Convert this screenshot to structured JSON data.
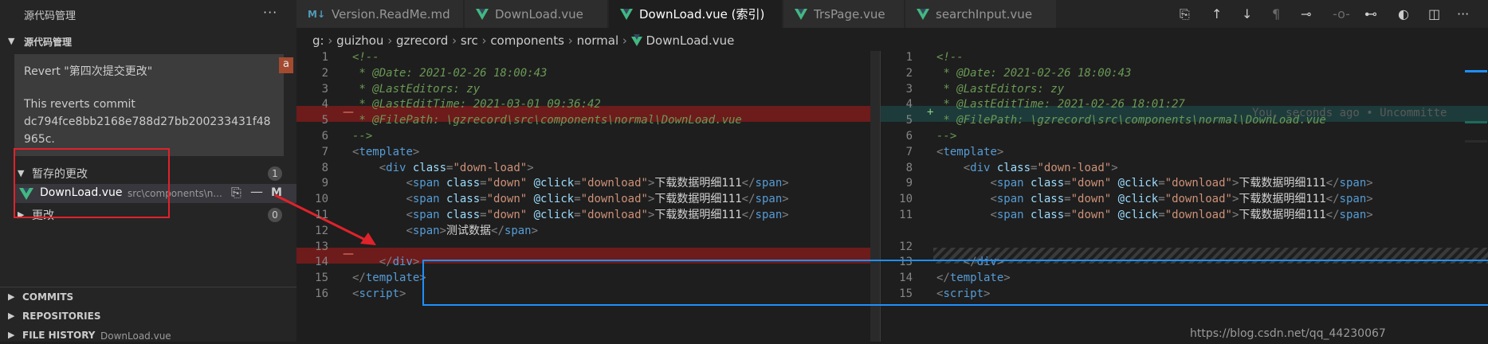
{
  "sidebar": {
    "title": "源代码管理",
    "more_icon": "ellipsis-icon",
    "scm_section": "源代码管理",
    "commit_message": {
      "lines": [
        "Revert \"第四次提交更改\"",
        "",
        "This reverts commit",
        "dc794fce8bb2168e788d27bb200233431f48",
        "965c."
      ],
      "badge": "a"
    },
    "staged": {
      "label": "暂存的更改",
      "count": "1"
    },
    "file": {
      "name": "DownLoad.vue",
      "path": "src\\components\\n...",
      "status": "M"
    },
    "changes": {
      "label": "更改",
      "count": "0"
    },
    "bottom_sections": [
      "COMMITS",
      "REPOSITORIES",
      "FILE HISTORY"
    ],
    "file_history_subtitle": "DownLoad.vue"
  },
  "tabs": [
    {
      "label": "Version.ReadMe.md",
      "icon": "markdown-icon",
      "active": false
    },
    {
      "label": "DownLoad.vue",
      "icon": "vue-icon",
      "active": false
    },
    {
      "label": "DownLoad.vue (索引)",
      "icon": "vue-icon",
      "active": true
    },
    {
      "label": "TrsPage.vue",
      "icon": "vue-icon",
      "active": false
    },
    {
      "label": "searchInput.vue",
      "icon": "vue-icon",
      "active": false
    }
  ],
  "breadcrumb": [
    "g:",
    "guizhou",
    "gzrecord",
    "src",
    "components",
    "normal",
    "DownLoad.vue"
  ],
  "left_editor": {
    "line_numbers": [
      "1",
      "2",
      "3",
      "4",
      "5",
      "6",
      "7",
      "8",
      "9",
      "10",
      "11",
      "12",
      "13",
      "14",
      "15",
      "16"
    ],
    "lines": [
      "<!--",
      " * @Date: 2021-02-26 18:00:43",
      " * @LastEditors: zy",
      " * @LastEditTime: 2021-03-01 09:36:42",
      " * @FilePath: \\gzrecord\\src\\components\\normal\\DownLoad.vue",
      "-->",
      "<template>",
      "    <div class=\"down-load\">",
      "        <span class=\"down\" @click=\"download\">下载数据明细111</span>",
      "        <span class=\"down\" @click=\"download\">下载数据明细111</span>",
      "        <span class=\"down\" @click=\"download\">下载数据明细111</span>",
      "        <span>测试数据</span>",
      "",
      "    </div>",
      "</template>",
      "<script>"
    ],
    "deleted_marker": "—"
  },
  "right_editor": {
    "line_numbers": [
      "1",
      "2",
      "3",
      "4",
      "5",
      "6",
      "7",
      "8",
      "9",
      "10",
      "11",
      "",
      "12",
      "13",
      "14",
      "15"
    ],
    "lines": [
      "<!--",
      " * @Date: 2021-02-26 18:00:43",
      " * @LastEditors: zy",
      " * @LastEditTime: 2021-02-26 18:01:27",
      " * @FilePath: \\gzrecord\\src\\components\\normal\\DownLoad.vue",
      "-->",
      "<template>",
      "    <div class=\"down-load\">",
      "        <span class=\"down\" @click=\"download\">下载数据明细111</span>",
      "        <span class=\"down\" @click=\"download\">下载数据明细111</span>",
      "        <span class=\"down\" @click=\"download\">下载数据明细111</span>",
      "",
      "",
      "    </div>",
      "</template>",
      "<script>"
    ],
    "added_marker": "+",
    "blame": "You, seconds ago • Uncommitte"
  },
  "watermark": "https://blog.csdn.net/qq_44230067",
  "colors": {
    "deleted_line": "#6e1b1b",
    "added_line": "#1d3b3b",
    "annotation_red": "#e0222a",
    "annotation_blue": "#1e90ff"
  }
}
